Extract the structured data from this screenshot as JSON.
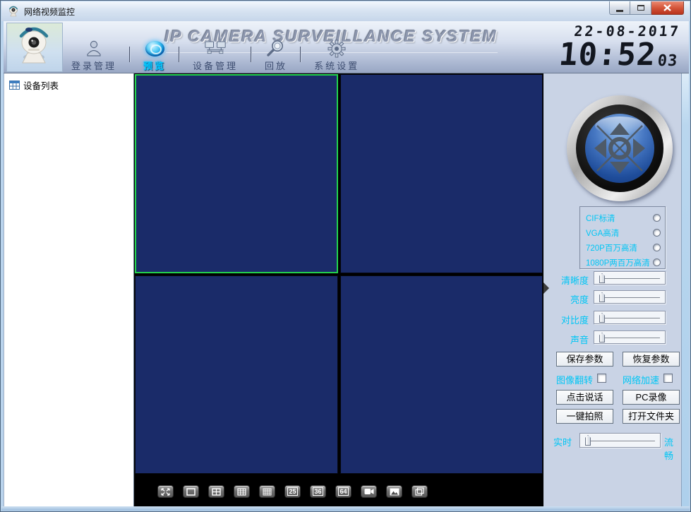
{
  "window": {
    "title": "网络视频监控"
  },
  "header": {
    "app_title": "IP CAMERA SURVEILLANCE SYSTEM",
    "date": "22-08-2017",
    "time_hm": "10:52",
    "time_s": "03",
    "nav": [
      {
        "label": "登录管理",
        "active": false
      },
      {
        "label": "预览",
        "active": true
      },
      {
        "label": "设备管理",
        "active": false
      },
      {
        "label": "回放",
        "active": false
      },
      {
        "label": "系统设置",
        "active": false
      }
    ]
  },
  "sidebar": {
    "device_list_label": "设备列表"
  },
  "right_panel": {
    "resolutions": [
      "CIF标清",
      "VGA高清",
      "720P百万高清",
      "1080P两百万高清"
    ],
    "slider_labels": [
      "清晰度",
      "亮度",
      "对比度",
      "声音"
    ],
    "buttons": {
      "save": "保存参数",
      "restore": "恢复参数",
      "talk": "点击说话",
      "pc_record": "PC录像",
      "snapshot": "一键拍照",
      "open_folder": "打开文件夹"
    },
    "checkboxes": [
      "图像翻转",
      "网络加速"
    ],
    "stream": {
      "left": "实时",
      "right": "流畅"
    }
  },
  "bottom_bar": {
    "counts": [
      "25",
      "36",
      "64"
    ]
  },
  "colors": {
    "accent_cyan": "#00c6f5",
    "video_panel_navy": "#1a2b69",
    "selected_green": "#23d24e",
    "panel_bg": "#c9d3e5",
    "close_red": "#c2452c"
  }
}
